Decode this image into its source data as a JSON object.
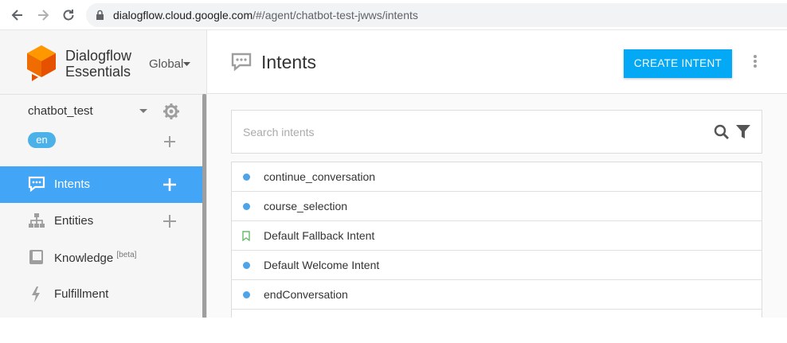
{
  "browser": {
    "url_host": "dialogflow.cloud.google.com",
    "url_path": "/#/agent/chatbot-test-jwws/intents"
  },
  "sidebar": {
    "brand_line1": "Dialogflow",
    "brand_line2": "Essentials",
    "region": "Global",
    "agent_name": "chatbot_test",
    "language": "en",
    "nav": [
      {
        "label": "Intents",
        "icon": "chat-bubble-icon",
        "active": true
      },
      {
        "label": "Entities",
        "icon": "hierarchy-icon",
        "active": false
      },
      {
        "label": "Knowledge",
        "sup": "[beta]",
        "icon": "book-icon",
        "active": false
      },
      {
        "label": "Fulfillment",
        "icon": "lightning-icon",
        "active": false
      }
    ]
  },
  "main": {
    "title": "Intents",
    "create_button": "CREATE INTENT",
    "search_placeholder": "Search intents",
    "intents": [
      {
        "name": "continue_conversation",
        "marker": "dot"
      },
      {
        "name": "course_selection",
        "marker": "dot"
      },
      {
        "name": "Default Fallback Intent",
        "marker": "bookmark"
      },
      {
        "name": "Default Welcome Intent",
        "marker": "dot"
      },
      {
        "name": "endConversation",
        "marker": "dot"
      }
    ]
  },
  "colors": {
    "accent": "#03a9f4",
    "active_nav": "#42a5f5",
    "dot": "#4fa3e7",
    "fallback_marker": "#66bb6a",
    "logo_orange": "#ef6c00"
  }
}
